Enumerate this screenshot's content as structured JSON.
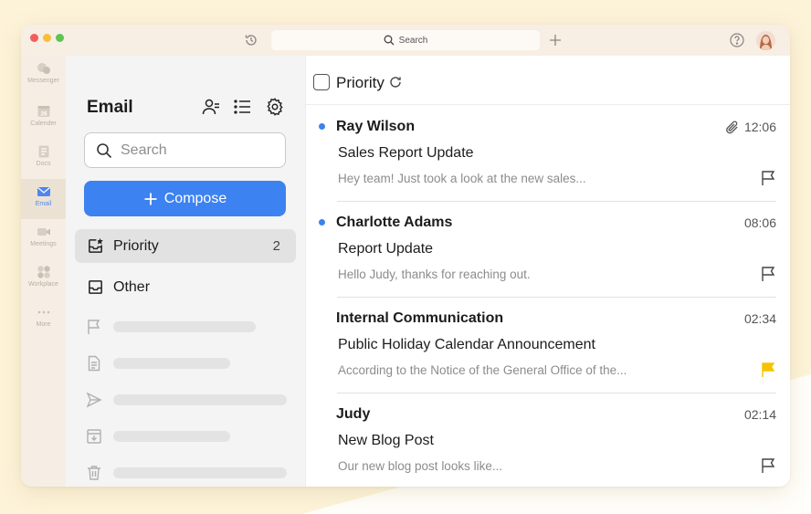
{
  "titlebar": {
    "search_label": "Search"
  },
  "rail": {
    "items": [
      {
        "label": "Messenger",
        "icon": "messenger-icon"
      },
      {
        "label": "Calender",
        "icon": "calendar-icon"
      },
      {
        "label": "Docs",
        "icon": "docs-icon"
      },
      {
        "label": "Email",
        "icon": "email-icon",
        "active": true
      },
      {
        "label": "Meetings",
        "icon": "meetings-icon"
      },
      {
        "label": "Workplace",
        "icon": "workplace-icon"
      },
      {
        "label": "More",
        "icon": "more-icon"
      }
    ],
    "calendar_day": "26"
  },
  "sidebar": {
    "title": "Email",
    "search_placeholder": "Search",
    "compose_label": "Compose",
    "folders": [
      {
        "label": "Priority",
        "count": "2",
        "icon": "priority-inbox-icon",
        "active": true
      },
      {
        "label": "Other",
        "count": "",
        "icon": "inbox-icon",
        "active": false
      }
    ]
  },
  "main": {
    "header_title": "Priority",
    "emails": [
      {
        "sender": "Ray Wilson",
        "time": "12:06",
        "subject": "Sales Report Update",
        "preview": "Hey team! Just took a look at the new sales...",
        "unread": true,
        "attachment": true,
        "flagged": false
      },
      {
        "sender": "Charlotte Adams",
        "time": "08:06",
        "subject": "Report Update",
        "preview": "Hello Judy, thanks for reaching out.",
        "unread": true,
        "attachment": false,
        "flagged": false
      },
      {
        "sender": "Internal Communication",
        "time": "02:34",
        "subject": "Public Holiday Calendar Announcement",
        "preview": "According to the Notice of the General Office of the...",
        "unread": false,
        "attachment": false,
        "flagged": true
      },
      {
        "sender": "Judy",
        "time": "02:14",
        "subject": "New Blog Post",
        "preview": "Our new blog post looks like...",
        "unread": false,
        "attachment": false,
        "flagged": false
      }
    ]
  },
  "colors": {
    "accent": "#3c82f0",
    "flag_active": "#f5c400",
    "background": "#fdf3d9"
  }
}
